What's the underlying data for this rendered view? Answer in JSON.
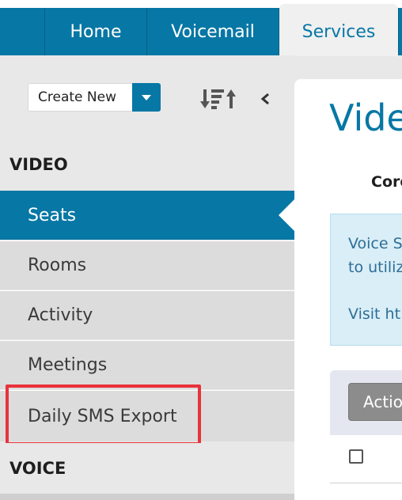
{
  "nav": {
    "tabs": [
      {
        "label": "Home"
      },
      {
        "label": "Voicemail"
      },
      {
        "label": "Services",
        "active": true
      }
    ]
  },
  "toolbar": {
    "create_new_label": "Create New",
    "icons": [
      "caret-down-icon",
      "sort-icon",
      "chevron-left-icon"
    ]
  },
  "sidebar": {
    "sections": [
      {
        "title": "VIDEO",
        "items": [
          {
            "label": "Seats",
            "active": true
          },
          {
            "label": "Rooms"
          },
          {
            "label": "Activity"
          },
          {
            "label": "Meetings"
          },
          {
            "label": "Daily SMS Export",
            "highlighted": true
          }
        ]
      },
      {
        "title": "VOICE",
        "items": []
      }
    ]
  },
  "main": {
    "title": "Vide",
    "core_label": "Core",
    "info_lines": [
      "Voice S",
      "to utiliz",
      "Visit ht"
    ],
    "table": {
      "action_button_label": "Actio"
    }
  },
  "colors": {
    "brand_blue": "#0777a5",
    "highlight_red": "#e8333a",
    "info_bg": "#d9eef7"
  }
}
